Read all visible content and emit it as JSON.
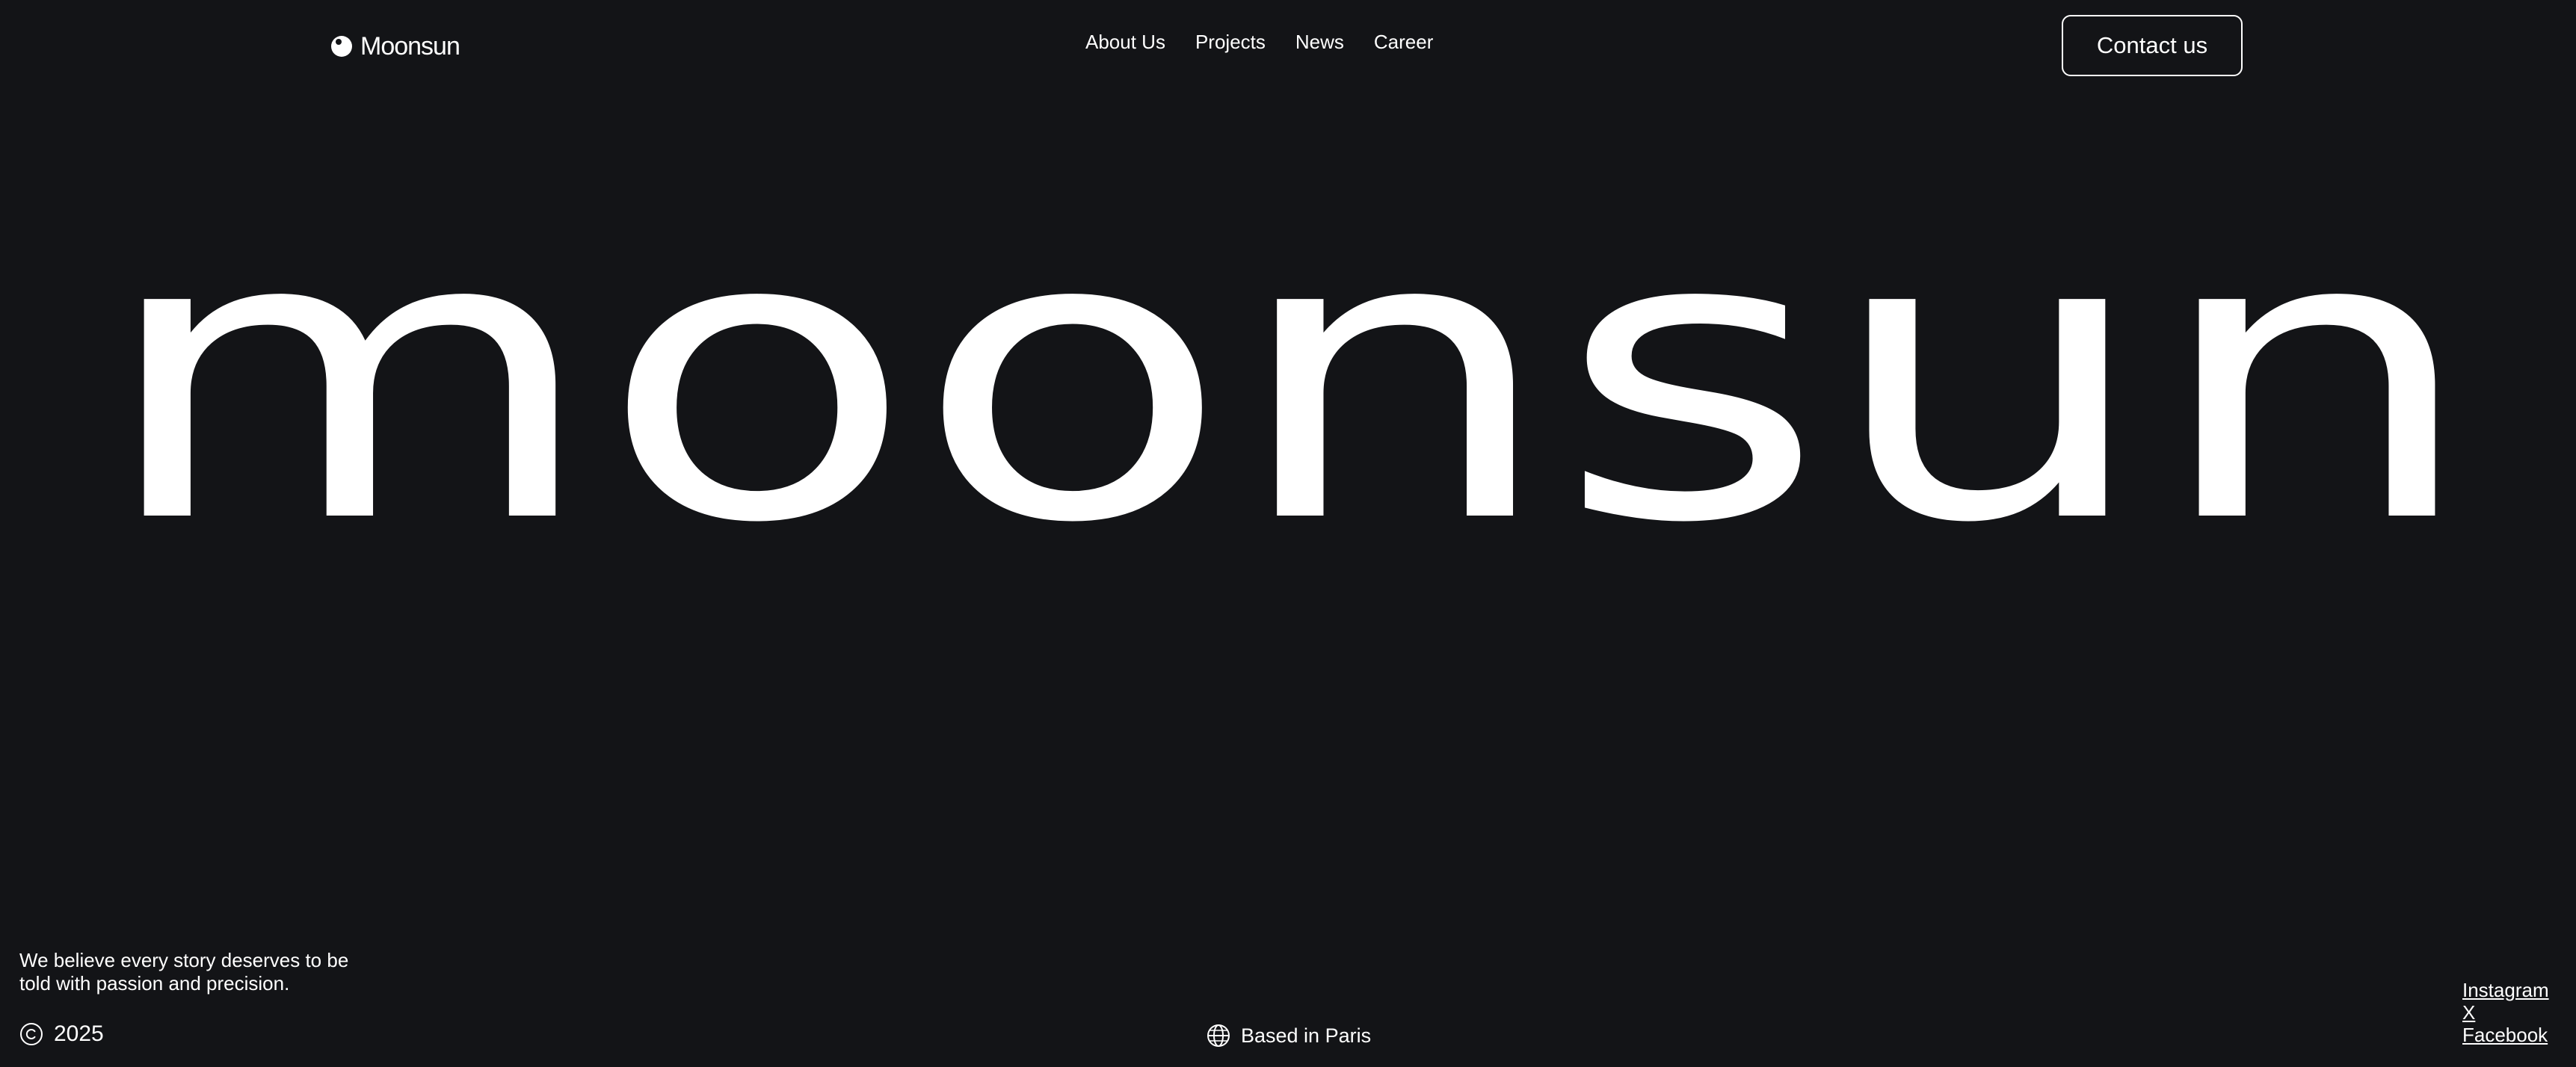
{
  "brand": {
    "name": "Moonsun",
    "icon": "moon-logo-icon"
  },
  "nav": {
    "items": [
      {
        "label": "About Us"
      },
      {
        "label": "Projects"
      },
      {
        "label": "News"
      },
      {
        "label": "Career"
      }
    ]
  },
  "header": {
    "contact_label": "Contact us"
  },
  "hero": {
    "wordmark": "moonsun"
  },
  "footer": {
    "tagline": "We believe every story deserves to be told with passion and precision.",
    "copyright_icon": "copyright-icon",
    "year": "2025",
    "location_icon": "globe-icon",
    "location": "Based in Paris",
    "social": [
      {
        "label": "Instagram"
      },
      {
        "label": "X"
      },
      {
        "label": "Facebook"
      }
    ]
  },
  "colors": {
    "background": "#131417",
    "foreground": "#ffffff"
  }
}
